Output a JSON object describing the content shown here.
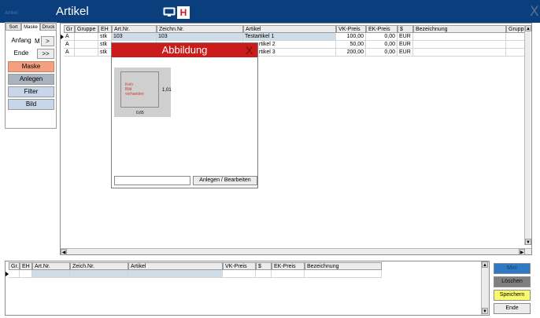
{
  "titlebar": {
    "small_title": "Artikel",
    "app_title": "Artikel",
    "h_label": "H",
    "close_label": "X"
  },
  "leftpanel": {
    "tabs": [
      "Sort",
      "Maske",
      "Druck"
    ],
    "anfang": "Anfang",
    "m_label": "M",
    "next": ">",
    "ende": "Ende",
    "last": ">>",
    "maske": "Maske",
    "anlegen": "Anlegen",
    "filter": "Filter",
    "bild": "Bild"
  },
  "grid": {
    "headers": [
      "Gr",
      "Gruppe",
      "EH",
      "Art.Nr.",
      "Zeichn.Nr.",
      "Artikel",
      "VK-Preis",
      "EK-Preis",
      "$",
      "Bezeichnung",
      "Gruppe"
    ],
    "rows": [
      {
        "gr": "A",
        "gruppe": "",
        "eh": "stk",
        "artnr": "103",
        "zeichnr": "103",
        "artikel": "Testartikel 1",
        "vk": "100,00",
        "ek": "0,00",
        "cur": "EUR",
        "bez": "",
        "gr2": ""
      },
      {
        "gr": "A",
        "gruppe": "",
        "eh": "stk",
        "artnr": "",
        "zeichnr": "",
        "artikel": "rtikel 2",
        "vk": "50,00",
        "ek": "0,00",
        "cur": "EUR",
        "bez": "",
        "gr2": ""
      },
      {
        "gr": "A",
        "gruppe": "",
        "eh": "stk",
        "artnr": "",
        "zeichnr": "",
        "artikel": "rtikel 3",
        "vk": "200,00",
        "ek": "0,00",
        "cur": "EUR",
        "bez": "",
        "gr2": ""
      }
    ]
  },
  "dialog": {
    "title": "Abbildung",
    "close_label": "X",
    "preview_text": [
      "Kein",
      "Bild",
      "vorhanden"
    ],
    "dim_height": "1,01",
    "dim_width": "0,65",
    "button_label": "Anlegen / Bearbeiten",
    "input_value": ""
  },
  "bottomgrid": {
    "headers": [
      "Gr.",
      "EH",
      "Art.Nr.",
      "Zeich.Nr.",
      "Artikel",
      "VK-Preis",
      "$",
      "EK-Preis",
      "Bezeichnung"
    ]
  },
  "actions": {
    "mini": "Mini",
    "loeschen": "Löschen",
    "speichern": "Speichern",
    "ende": "Ende"
  },
  "colors": {
    "titlebar": "#0b3e7d",
    "dialog_title": "#cc1b1b",
    "maske": "#f2a07f",
    "speichern": "#fbfb6f",
    "mini": "#2f79c4"
  }
}
